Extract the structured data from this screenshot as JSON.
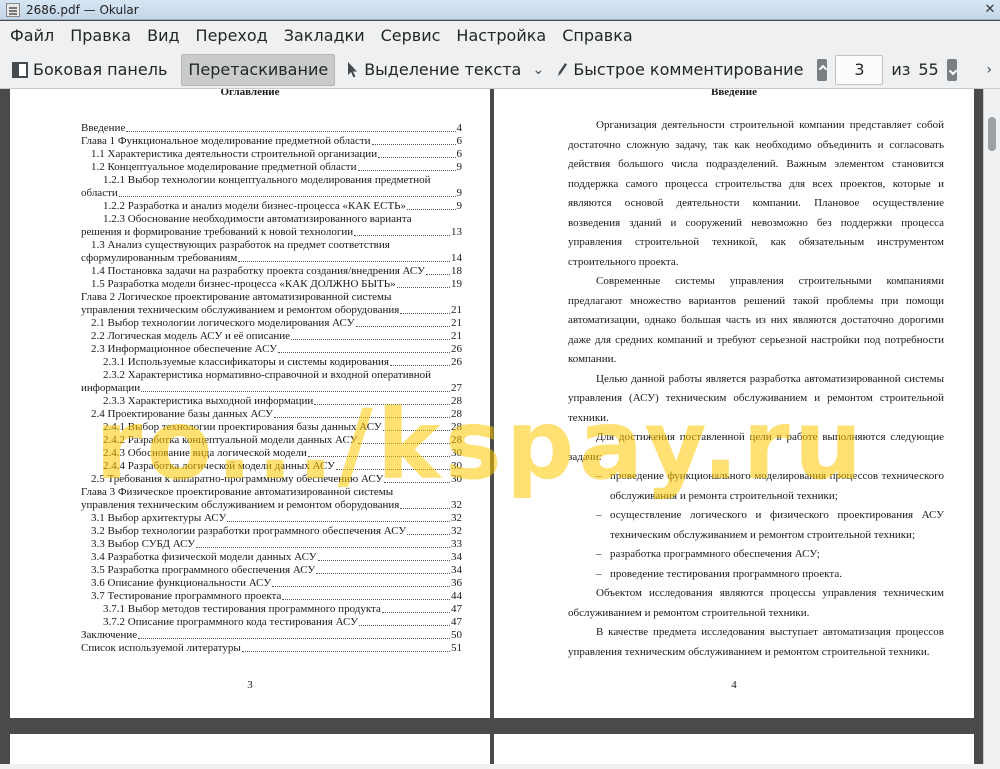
{
  "window": {
    "title": "2686.pdf — Okular"
  },
  "menu": [
    "Файл",
    "Правка",
    "Вид",
    "Переход",
    "Закладки",
    "Сервис",
    "Настройка",
    "Справка"
  ],
  "toolbar": {
    "sidebar_label": "Боковая панель",
    "drag_label": "Перетаскивание",
    "text_select_label": "Выделение текста",
    "quick_annot_label": "Быстрое комментирование",
    "current_page": "3",
    "of_label": "из",
    "total_pages": "55"
  },
  "watermark": "ro.../kspay.ru",
  "page3": {
    "title": "Оглавление",
    "number": "3",
    "toc": [
      {
        "text": "Введение",
        "page": "4",
        "level": 0
      },
      {
        "text": "Глава 1 Функциональное моделирование предметной области",
        "page": "6",
        "level": 0
      },
      {
        "text": "1.1 Характеристика деятельности строительной организации",
        "page": "6",
        "level": 1
      },
      {
        "text": "1.2 Концептуальное моделирование предметной области",
        "page": "9",
        "level": 1
      },
      {
        "text": "1.2.1 Выбор технологии концептуального моделирования предметной",
        "cont": "области",
        "page": "9",
        "level": 2
      },
      {
        "text": "1.2.2 Разработка и анализ модели бизнес-процесса «КАК ЕСТЬ»",
        "page": "9",
        "level": 2
      },
      {
        "text": "1.2.3 Обоснование необходимости автоматизированного варианта",
        "cont": "решения и формирование требований к новой технологии",
        "page": "13",
        "level": 2
      },
      {
        "text": "1.3 Анализ существующих разработок на предмет соответствия",
        "cont": "сформулированным требованиям",
        "page": "14",
        "level": 1
      },
      {
        "text": "1.4 Постановка задачи на разработку проекта создания/внедрения АСУ",
        "page": "18",
        "level": 1
      },
      {
        "text": "1.5 Разработка модели бизнес-процесса «КАК ДОЛЖНО БЫТЬ»",
        "page": "19",
        "level": 1
      },
      {
        "text": "Глава 2 Логическое проектирование автоматизированной системы",
        "cont": "управления техническим обслуживанием и ремонтом оборудования",
        "page": "21",
        "level": 0
      },
      {
        "text": "2.1 Выбор технологии логического моделирования АСУ",
        "page": "21",
        "level": 1
      },
      {
        "text": "2.2 Логическая модель АСУ и её описание",
        "page": "21",
        "level": 1
      },
      {
        "text": "2.3 Информационное обеспечение АСУ",
        "page": "26",
        "level": 1
      },
      {
        "text": "2.3.1 Используемые классификаторы и системы кодирования",
        "page": "26",
        "level": 2
      },
      {
        "text": "2.3.2 Характеристика нормативно-справочной и входной оперативной",
        "cont": "информации",
        "page": "27",
        "level": 2
      },
      {
        "text": "2.3.3 Характеристика выходной информации",
        "page": "28",
        "level": 2
      },
      {
        "text": "2.4 Проектирование базы данных АСУ",
        "page": "28",
        "level": 1
      },
      {
        "text": "2.4.1 Выбор технологии проектирования базы данных АСУ",
        "page": "28",
        "level": 2
      },
      {
        "text": "2.4.2 Разработка концептуальной модели данных АСУ",
        "page": "28",
        "level": 2
      },
      {
        "text": "2.4.3 Обоснование вида логической модели",
        "page": "30",
        "level": 2
      },
      {
        "text": "2.4.4 Разработка логической модели данных АСУ",
        "page": "30",
        "level": 2
      },
      {
        "text": "2.5 Требования к аппаратно-программному обеспечению АСУ",
        "page": "30",
        "level": 1
      },
      {
        "text": "Глава 3 Физическое проектирование автоматизированной системы",
        "cont": "управления техническим обслуживанием и ремонтом оборудования",
        "page": "32",
        "level": 0
      },
      {
        "text": "3.1 Выбор архитектуры АСУ",
        "page": "32",
        "level": 1
      },
      {
        "text": "3.2 Выбор технологии разработки программного обеспечения АСУ",
        "page": "32",
        "level": 1
      },
      {
        "text": "3.3 Выбор СУБД АСУ",
        "page": "33",
        "level": 1
      },
      {
        "text": "3.4 Разработка физической модели данных АСУ",
        "page": "34",
        "level": 1
      },
      {
        "text": "3.5 Разработка программного обеспечения АСУ",
        "page": "34",
        "level": 1
      },
      {
        "text": "3.6 Описание функциональности АСУ",
        "page": "36",
        "level": 1
      },
      {
        "text": "3.7 Тестирование программного проекта",
        "page": "44",
        "level": 1
      },
      {
        "text": "3.7.1 Выбор методов тестирования программного продукта",
        "page": "47",
        "level": 2
      },
      {
        "text": "3.7.2 Описание программного кода тестирования АСУ",
        "page": "47",
        "level": 2
      },
      {
        "text": "Заключение",
        "page": "50",
        "level": 0
      },
      {
        "text": "Список используемой литературы",
        "page": "51",
        "level": 0
      }
    ]
  },
  "page4": {
    "title": "Введение",
    "number": "4",
    "paragraphs": [
      "Организация деятельности строительной компании представляет собой достаточно сложную задачу, так как необходимо объединить и согласовать действия большого числа подразделений. Важным элементом становится поддержка самого процесса строительства для всех проектов, которые и являются основой деятельности компании. Плановое осуществление возведения зданий и сооружений невозможно без поддержки процесса управления строительной техникой, как обязательным инструментом строительного проекта.",
      "Современные системы управления строительными компаниями предлагают множество вариантов решений такой проблемы при помощи автоматизации, однако большая часть из них являются достаточно дорогими даже для средних компаний и требуют серьезной настройки под потребности компании.",
      "Целью данной работы является разработка автоматизированной системы управления (АСУ) техническим обслуживанием и ремонтом строительной техники.",
      "Для достижения поставленной цели в работе выполняются следующие задачи:"
    ],
    "tasks": [
      "проведение функционального моделирования процессов технического обслуживания и ремонта строительной техники;",
      "осуществление логического и физического проектирования АСУ техническим обслуживанием и ремонтом строительной техники;",
      "разработка программного обеспечения АСУ;",
      "проведение тестирования программного проекта."
    ],
    "after": [
      "Объектом исследования являются процессы управления техническим обслуживанием и ремонтом строительной техники.",
      "В качестве предмета исследования выступает автоматизация процессов управления техническим обслуживанием и ремонтом строительной техники."
    ]
  }
}
